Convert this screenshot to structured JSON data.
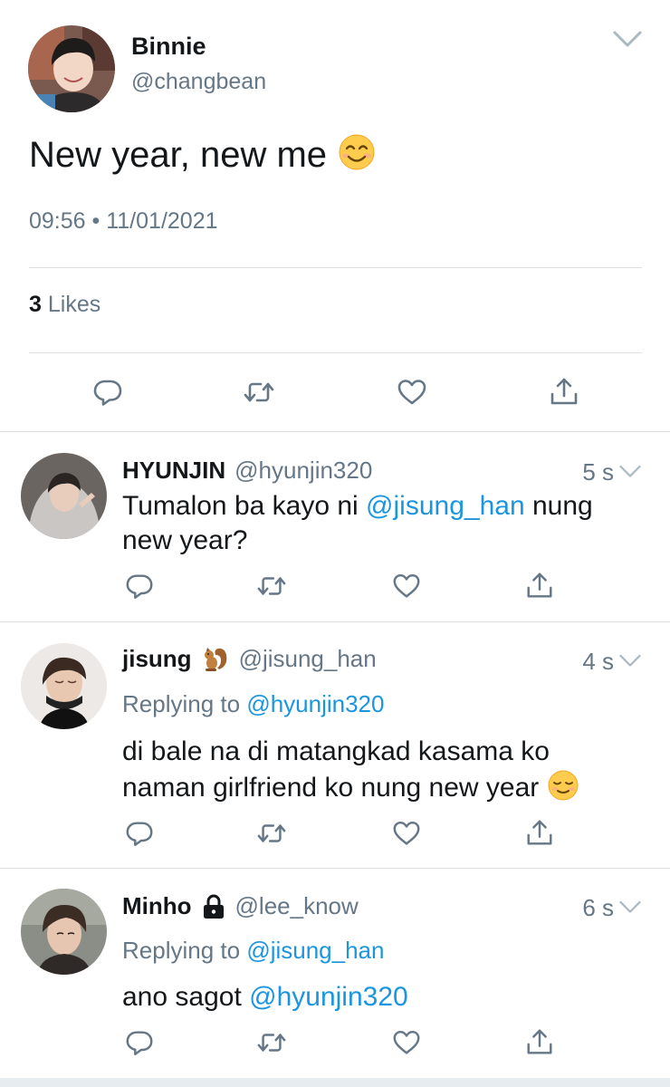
{
  "main_tweet": {
    "name": "Binnie",
    "handle": "@changbean",
    "text": "New year, new me",
    "time": "09:56",
    "separator": "•",
    "date": "11/01/2021",
    "likes_count": "3",
    "likes_label": "Likes"
  },
  "replies": [
    {
      "name": "HYUNJIN",
      "handle": "@hyunjin320",
      "time": "5 s",
      "text_before": "Tumalon ba kayo ni ",
      "mention": "@jisung_han",
      "text_after": " nung new year?"
    },
    {
      "name": "jisung",
      "handle": "@jisung_han",
      "time": "4 s",
      "replying_label": "Replying to",
      "replying_to": "@hyunjin320",
      "text": "di bale na di matangkad kasama ko naman girlfriend ko nung new year"
    },
    {
      "name": "Minho",
      "handle": "@lee_know",
      "time": "6 s",
      "replying_label": "Replying to",
      "replying_to": "@jisung_han",
      "text_before": "ano sagot ",
      "mention": "@hyunjin320"
    }
  ],
  "icons": [
    "chevron-down-icon",
    "reply-icon",
    "retweet-icon",
    "like-icon",
    "share-icon",
    "squirrel-icon",
    "lock-icon",
    "smiling-face-icon",
    "relieved-face-icon"
  ],
  "colors": {
    "link": "#1b95e0",
    "secondary_text": "#657786",
    "divider": "#dcdfe3",
    "icon": "#657786"
  }
}
